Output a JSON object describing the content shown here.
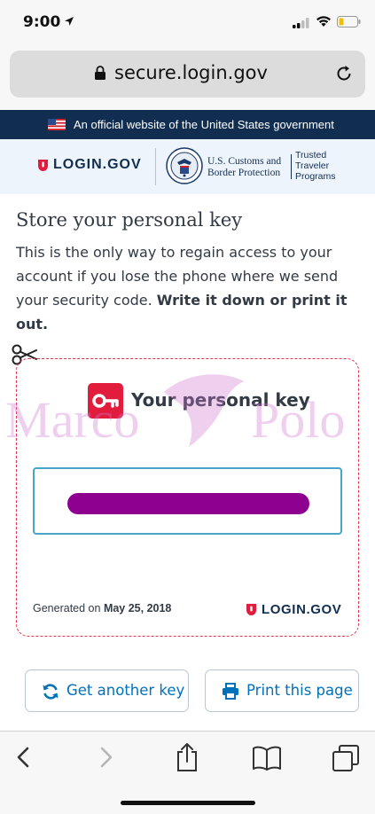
{
  "status_bar": {
    "time": "9:00"
  },
  "browser": {
    "url": "secure.login.gov"
  },
  "gov_banner": {
    "text": "An official website of the United States government"
  },
  "header": {
    "login_logo": "LOGIN.GOV",
    "cbp_line1": "U.S. Customs and",
    "cbp_line2": "Border Protection",
    "ttp_line1": "Trusted",
    "ttp_line2": "Traveler",
    "ttp_line3": "Programs"
  },
  "page": {
    "title": "Store your personal key",
    "intro": "This is the only way to regain access to your account if you lose the phone where we send your security code.",
    "intro_emphasis": "Write it down or print it out."
  },
  "key_card": {
    "title": "Your personal key",
    "generated_label": "Generated on",
    "generated_date": "May 25, 2018",
    "logo": "LOGIN.GOV"
  },
  "actions": {
    "get_another_key": "Get another key",
    "print_page": "Print this page"
  },
  "watermark": {
    "left": "Marco",
    "right": "Polo"
  },
  "colors": {
    "navy": "#112e51",
    "red": "#e21c3d",
    "link_blue": "#0071bb",
    "key_box_border": "#4aa3c9",
    "redacted": "#8e0090"
  },
  "icons": [
    "location-arrow-icon",
    "signal-icon",
    "wifi-icon",
    "battery-icon",
    "lock-icon",
    "reload-icon",
    "us-flag-icon",
    "shield-icon",
    "dhs-seal-icon",
    "scissors-icon",
    "key-icon",
    "refresh-icon",
    "printer-icon",
    "back-icon",
    "forward-icon",
    "share-icon",
    "bookmarks-icon",
    "tabs-icon"
  ]
}
